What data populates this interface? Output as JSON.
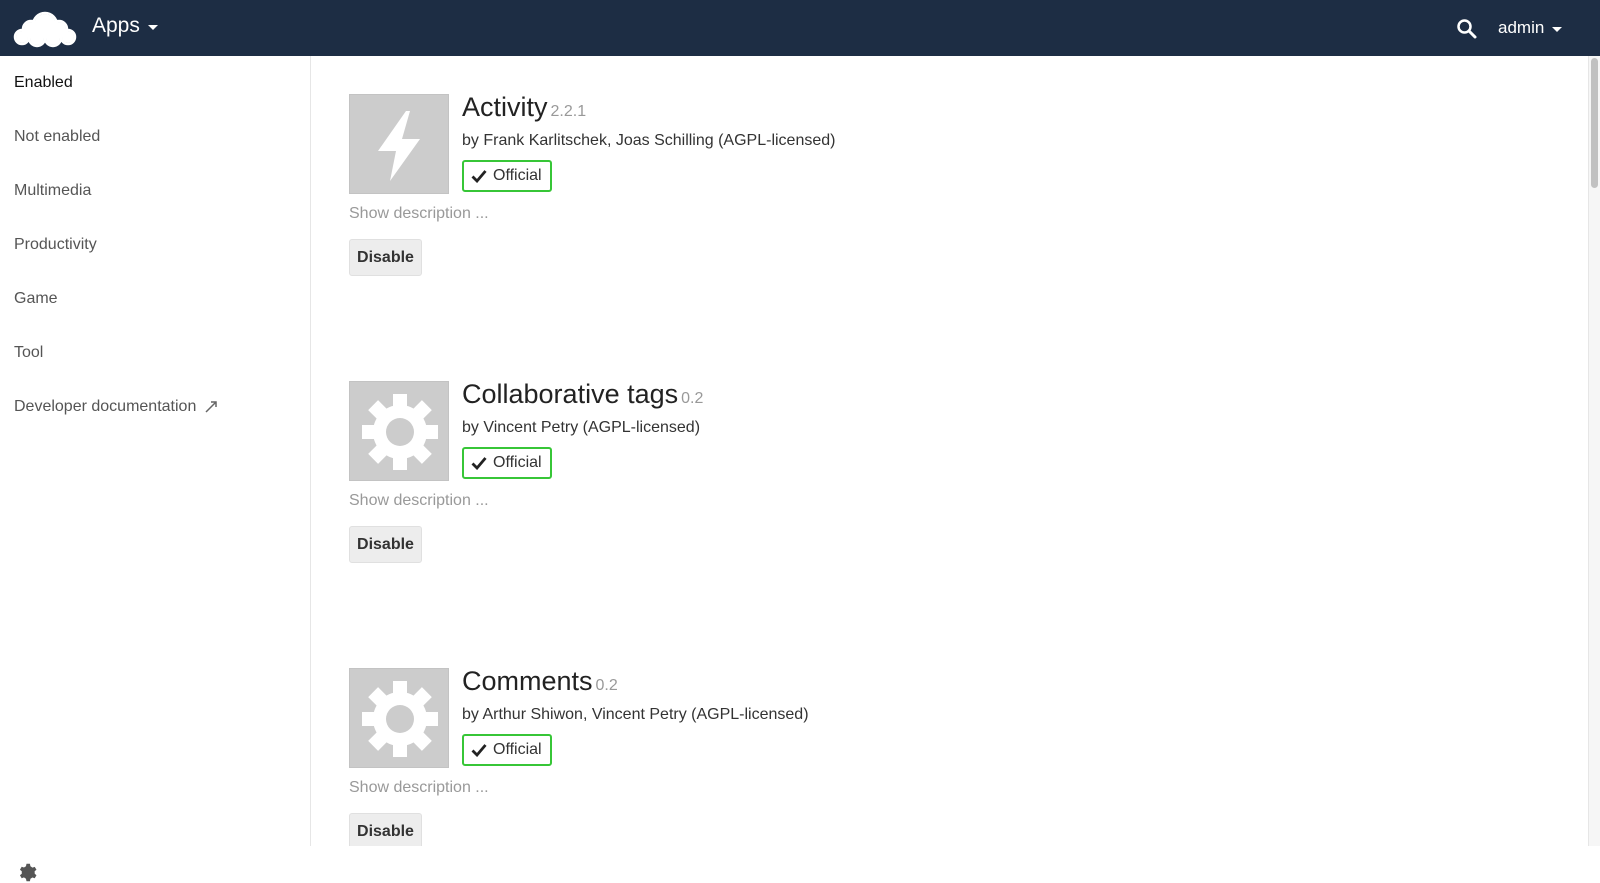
{
  "header": {
    "app_menu_label": "Apps",
    "user_label": "admin",
    "background_color": "#1d2d44"
  },
  "sidebar": {
    "items": [
      {
        "label": "Enabled",
        "active": true
      },
      {
        "label": "Not enabled"
      },
      {
        "label": "Multimedia"
      },
      {
        "label": "Productivity"
      },
      {
        "label": "Game"
      },
      {
        "label": "Tool"
      },
      {
        "label": "Developer documentation",
        "icon": "external-link-icon"
      }
    ],
    "settings_icon": "gear-icon"
  },
  "apps": [
    {
      "name": "Activity",
      "version": "2.2.1",
      "author": "by Frank Karlitschek, Joas Schilling (AGPL-licensed)",
      "badge": "Official",
      "show_description": "Show description ...",
      "button": "Disable",
      "icon": "lightning-icon"
    },
    {
      "name": "Collaborative tags",
      "version": "0.2",
      "author": "by Vincent Petry (AGPL-licensed)",
      "badge": "Official",
      "show_description": "Show description ...",
      "button": "Disable",
      "icon": "gear-icon"
    },
    {
      "name": "Comments",
      "version": "0.2",
      "author": "by Arthur Shiwon, Vincent Petry (AGPL-licensed)",
      "badge": "Official",
      "show_description": "Show description ...",
      "button": "Disable",
      "icon": "gear-icon"
    }
  ],
  "colors": {
    "badge_border": "#37c637",
    "icon_bg": "#cccccc"
  }
}
